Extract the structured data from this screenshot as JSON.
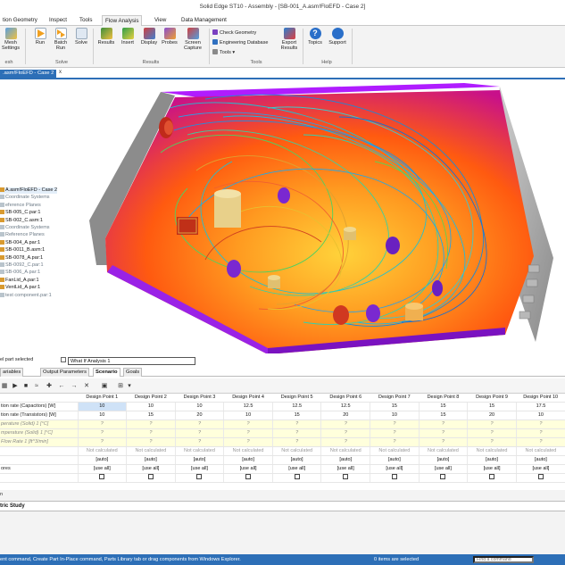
{
  "app": {
    "title": "Solid Edge ST10 - Assembly - [SB-001_A.asm!FloEFD - Case 2]"
  },
  "ribbon_tabs": [
    "tion Geometry",
    "Inspect",
    "Tools",
    "Flow Analysis",
    "View",
    "Data Management"
  ],
  "ribbon": {
    "mesh": "Mesh\nSettings",
    "run": "Run",
    "batch_run": "Batch\nRun",
    "solve": "Solve",
    "results": "Results",
    "insert": "Insert",
    "display": "Display",
    "probes": "Probes",
    "screen_capture": "Screen\nCapture",
    "check_geometry": "Check Geometry",
    "engineering_database": "Engineering Database",
    "tools_menu": "Tools",
    "export_results": "Export\nResults",
    "topics": "Topics",
    "support": "Support",
    "group_mesh": "esh",
    "group_solve": "Solve",
    "group_results": "Results",
    "group_tools": "Tools",
    "group_help": "Help"
  },
  "doc_tab": {
    "label": ".asm!FloEFD - Case 2",
    "close": "x"
  },
  "tree": {
    "items": [
      {
        "label": "A.asm!FloEFD - Case 2",
        "style": "hl"
      },
      {
        "label": "Coordinate Systems",
        "style": "gray"
      },
      {
        "label": "eference Planes",
        "style": "gray"
      },
      {
        "label": "SB-005_C.par:1",
        "style": ""
      },
      {
        "label": "SB-002_C.asm:1",
        "style": ""
      },
      {
        "label": "Coordinate Systems",
        "style": "gray"
      },
      {
        "label": "Reference Planes",
        "style": "gray"
      },
      {
        "label": "SB-004_A.par:1",
        "style": ""
      },
      {
        "label": "SB-0011_B.asm:1",
        "style": ""
      },
      {
        "label": "SB-0078_A.par:1",
        "style": ""
      },
      {
        "label": "SB-0092_C.par:1",
        "style": "gray"
      },
      {
        "label": "SB-006_A.par:1",
        "style": "gray"
      },
      {
        "label": "FanLid_A.par:1",
        "style": ""
      },
      {
        "label": "VentLid_A.par:1",
        "style": ""
      },
      {
        "label": "test component.par:1",
        "style": "gray"
      }
    ]
  },
  "prop_bar": {
    "selection": "el part selected",
    "analysis": "What If Analysis 1"
  },
  "feature_tabs": [
    "ariables",
    "Output Parameters",
    "Scenario",
    "Goals"
  ],
  "grid": {
    "columns": [
      "Design Point 1",
      "Design Point 2",
      "Design Point 3",
      "Design Point 4",
      "Design Point 5",
      "Design Point 6",
      "Design Point 7",
      "Design Point 8",
      "Design Point 9",
      "Design Point 10"
    ],
    "rows": [
      {
        "label": "tion rate (Capacitors) [W]",
        "cls": "white",
        "values": [
          "10",
          "10",
          "10",
          "12.5",
          "12.5",
          "12.5",
          "15",
          "15",
          "15",
          "17.5"
        ]
      },
      {
        "label": "tion rate (Transistors) [W]",
        "cls": "white",
        "values": [
          "10",
          "15",
          "20",
          "10",
          "15",
          "20",
          "10",
          "15",
          "20",
          "10"
        ]
      },
      {
        "label": "perature (Solid) 1 [°C]",
        "cls": "yel",
        "values": [
          "?",
          "?",
          "?",
          "?",
          "?",
          "?",
          "?",
          "?",
          "?",
          "?"
        ]
      },
      {
        "label": "mperature (Solid) 1 [°C]",
        "cls": "yel",
        "values": [
          "?",
          "?",
          "?",
          "?",
          "?",
          "?",
          "?",
          "?",
          "?",
          "?"
        ]
      },
      {
        "label": "Flow Rate 1 [ft^3/min]",
        "cls": "yel",
        "values": [
          "?",
          "?",
          "?",
          "?",
          "?",
          "?",
          "?",
          "?",
          "?",
          "?"
        ]
      },
      {
        "label": "",
        "cls": "grey",
        "values": [
          "Not calculated",
          "Not calculated",
          "Not calculated",
          "Not calculated",
          "Not calculated",
          "Not calculated",
          "Not calculated",
          "Not calculated",
          "Not calculated",
          "Not calculated"
        ]
      },
      {
        "label": "",
        "cls": "white",
        "values": [
          "[auto]",
          "[auto]",
          "[auto]",
          "[auto]",
          "[auto]",
          "[auto]",
          "[auto]",
          "[auto]",
          "[auto]",
          "[auto]"
        ]
      },
      {
        "label": "ores",
        "cls": "white",
        "values": [
          "[use all]",
          "[use all]",
          "[use all]",
          "[use all]",
          "[use all]",
          "[use all]",
          "[use all]",
          "[use all]",
          "[use all]",
          "[use all]"
        ]
      }
    ]
  },
  "lower": {
    "tab": "tric Study",
    "label": "n"
  },
  "status": {
    "message": "ent command, Create Part In-Place command, Parts Library tab or drag components from Windows Explorer.",
    "items_selected": "0 items are selected",
    "find_placeholder": "Find a command"
  },
  "colors": {
    "accent": "#2d6fb7",
    "enclosure": "#a020f0",
    "selection": "#cfe2f7"
  }
}
